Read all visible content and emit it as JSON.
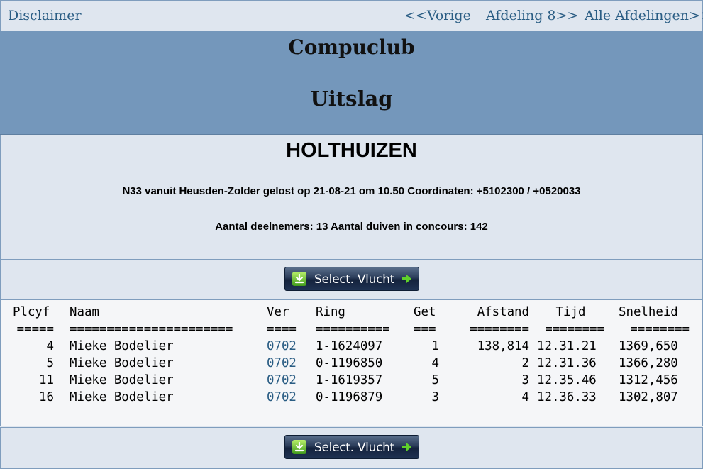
{
  "nav": {
    "disclaimer": "Disclaimer",
    "previous": "<<Vorige",
    "next": "Afdeling 8>>",
    "all": "Alle Afdelingen>>"
  },
  "banner": {
    "club": "Compuclub",
    "title": "Uitslag"
  },
  "info": {
    "club_name": "HOLTHUIZEN",
    "race_line": "N33 vanuit Heusden-Zolder gelost op 21-08-21 om 10.50 Coordinaten: +5102300 / +0520033",
    "count_line": "Aantal deelnemers: 13 Aantal duiven in concours: 142"
  },
  "select_button": {
    "label": "Select. Vlucht"
  },
  "table": {
    "headers": [
      "Plcyf",
      "Naam",
      "Ver",
      "Ring",
      "Get",
      "Afstand",
      "Tijd",
      "Snelheid"
    ],
    "separators": [
      "=====",
      "======================",
      "====",
      "==========",
      "===",
      "========",
      "========",
      "========"
    ],
    "rows": [
      [
        "4",
        "Mieke Bodelier",
        "0702",
        "1-1624097",
        "1",
        "138,814",
        "12.31.21",
        "1369,650"
      ],
      [
        "5",
        "Mieke Bodelier",
        "0702",
        "0-1196850",
        "4",
        "2",
        "12.31.36",
        "1366,280"
      ],
      [
        "11",
        "Mieke Bodelier",
        "0702",
        "1-1619357",
        "5",
        "3",
        "12.35.46",
        "1312,456"
      ],
      [
        "16",
        "Mieke Bodelier",
        "0702",
        "0-1196879",
        "3",
        "4",
        "12.36.33",
        "1302,807"
      ]
    ]
  },
  "colors": {
    "banner": "#7497bb",
    "page_bg": "#dfe6ef",
    "link": "#2a5d84"
  }
}
